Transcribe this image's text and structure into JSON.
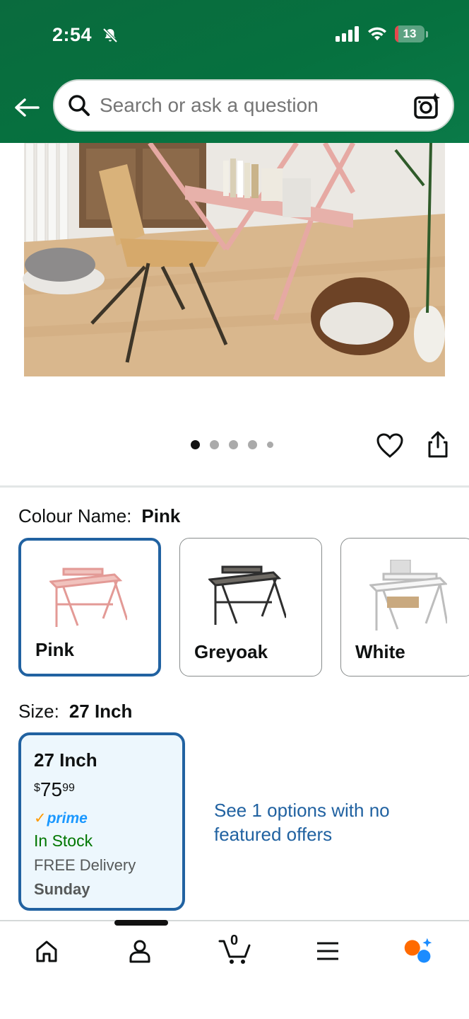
{
  "status_bar": {
    "time": "2:54",
    "battery": "13",
    "battery_level": 0.13
  },
  "search": {
    "placeholder": "Search or ask a question"
  },
  "carousel": {
    "image_count": 5,
    "active_index": 0
  },
  "colour": {
    "label": "Colour Name:",
    "selected": "Pink",
    "options": [
      {
        "name": "Pink",
        "selected": true
      },
      {
        "name": "Greyoak",
        "selected": false
      },
      {
        "name": "White",
        "selected": false
      }
    ]
  },
  "size": {
    "label": "Size:",
    "selected": "27 Inch",
    "card": {
      "title": "27 Inch",
      "currency": "$",
      "price_whole": "75",
      "price_fraction": "99",
      "prime": "prime",
      "stock": "In Stock",
      "delivery": "FREE Delivery",
      "delivery_day": "Sunday"
    },
    "options_link": "See 1 options with no featured offers"
  },
  "tabbar": {
    "cart_count": "0"
  },
  "colors": {
    "header_green": "#06713f",
    "selected_border": "#2162a1",
    "in_stock": "#007600",
    "prime_blue": "#1a98ff"
  }
}
